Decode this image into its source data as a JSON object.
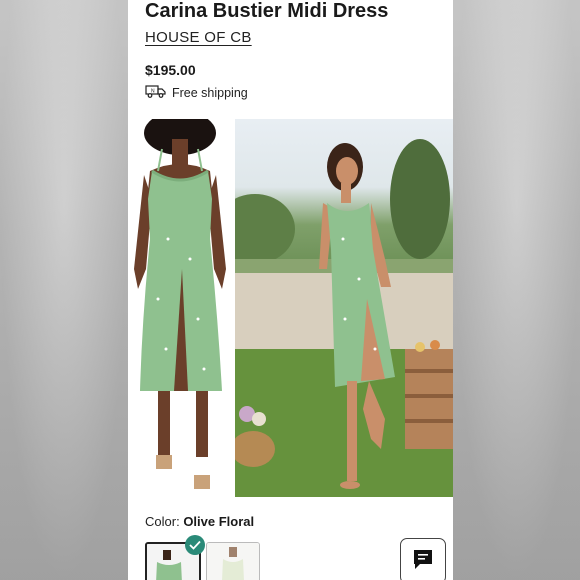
{
  "product": {
    "title": "Carina Bustier Midi Dress",
    "brand": "HOUSE OF CB",
    "price": "$195.00",
    "shipping_text": "Free shipping"
  },
  "color": {
    "label": "Color:",
    "selected_value": "Olive Floral"
  },
  "icons": {
    "shipping": "delivery-truck-icon",
    "selected": "checkmark-icon",
    "chat": "chat-bubble-icon"
  },
  "colors": {
    "dress_green": "#8fc18f",
    "check_teal": "#2a8a78"
  }
}
